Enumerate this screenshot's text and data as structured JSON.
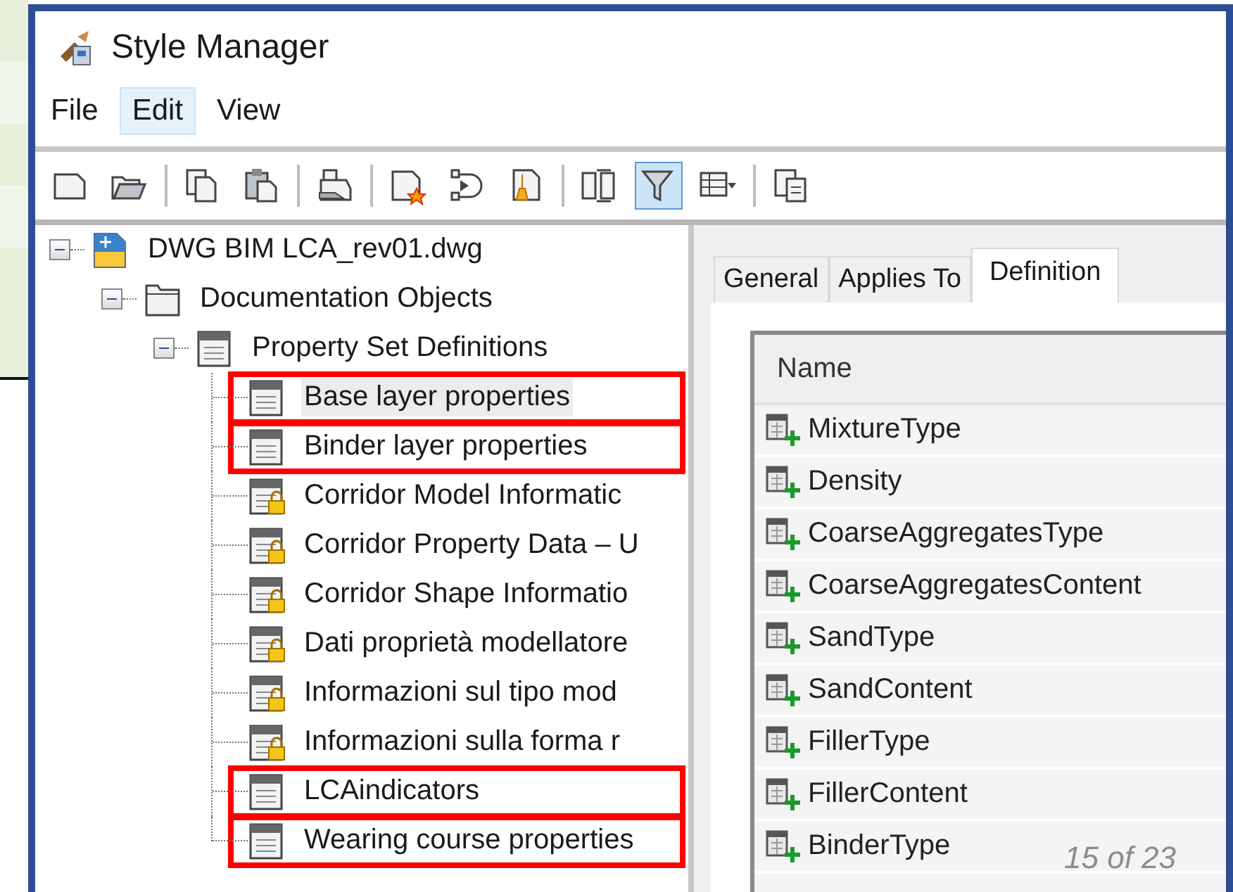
{
  "window": {
    "title": "Style Manager"
  },
  "menu": [
    {
      "label": "File",
      "selected": false
    },
    {
      "label": "Edit",
      "selected": true
    },
    {
      "label": "View",
      "selected": false
    }
  ],
  "toolbar": [
    {
      "kind": "new",
      "on": false
    },
    {
      "kind": "open",
      "on": false
    },
    {
      "kind": "separator"
    },
    {
      "kind": "copy",
      "on": false
    },
    {
      "kind": "paste",
      "on": false
    },
    {
      "kind": "separator"
    },
    {
      "kind": "purge",
      "on": false
    },
    {
      "kind": "separator"
    },
    {
      "kind": "new-style",
      "on": false
    },
    {
      "kind": "cycle",
      "on": false
    },
    {
      "kind": "clean",
      "on": false
    },
    {
      "kind": "separator"
    },
    {
      "kind": "compare",
      "on": false
    },
    {
      "kind": "filter",
      "on": true
    },
    {
      "kind": "view-menu",
      "on": false
    },
    {
      "kind": "separator"
    },
    {
      "kind": "toggle",
      "on": false
    }
  ],
  "tree": [
    {
      "label": "DWG BIM LCA_rev01.dwg",
      "kind": "drawing",
      "expanded": true,
      "selected": false,
      "children": [
        {
          "label": "Documentation Objects",
          "kind": "folder",
          "expanded": true,
          "selected": false,
          "children": [
            {
              "label": "Property Set Definitions",
              "kind": "definitions",
              "expanded": true,
              "selected": false,
              "children": [
                {
                  "label": "Base layer properties",
                  "kind": "definition",
                  "locked": false,
                  "selected": true,
                  "highlighted": true
                },
                {
                  "label": "Binder layer properties",
                  "kind": "definition",
                  "locked": false,
                  "selected": false,
                  "highlighted": true
                },
                {
                  "label": "Corridor Model Informatic",
                  "kind": "definition",
                  "locked": true,
                  "selected": false,
                  "highlighted": false
                },
                {
                  "label": "Corridor Property Data – U",
                  "kind": "definition",
                  "locked": true,
                  "selected": false,
                  "highlighted": false
                },
                {
                  "label": "Corridor Shape Informatio",
                  "kind": "definition",
                  "locked": true,
                  "selected": false,
                  "highlighted": false
                },
                {
                  "label": "Dati proprietà modellatore",
                  "kind": "definition",
                  "locked": true,
                  "selected": false,
                  "highlighted": false
                },
                {
                  "label": "Informazioni sul tipo mod",
                  "kind": "definition",
                  "locked": true,
                  "selected": false,
                  "highlighted": false
                },
                {
                  "label": "Informazioni sulla forma r",
                  "kind": "definition",
                  "locked": true,
                  "selected": false,
                  "highlighted": false
                },
                {
                  "label": "LCAindicators",
                  "kind": "definition",
                  "locked": false,
                  "selected": false,
                  "highlighted": true
                },
                {
                  "label": "Wearing course properties",
                  "kind": "definition",
                  "locked": false,
                  "selected": false,
                  "highlighted": true
                }
              ]
            }
          ]
        }
      ]
    }
  ],
  "tabs": [
    {
      "label": "General",
      "selected": false
    },
    {
      "label": "Applies To",
      "selected": false
    },
    {
      "label": "Definition",
      "selected": true
    }
  ],
  "table": {
    "columns": [
      "Name"
    ],
    "rows": [
      {
        "name": "MixtureType"
      },
      {
        "name": "Density"
      },
      {
        "name": "CoarseAggregatesType"
      },
      {
        "name": "CoarseAggregatesContent"
      },
      {
        "name": "SandType"
      },
      {
        "name": "SandContent"
      },
      {
        "name": "FillerType"
      },
      {
        "name": "FillerContent"
      },
      {
        "name": "BinderType"
      }
    ]
  },
  "slide_number": "15 of 23"
}
